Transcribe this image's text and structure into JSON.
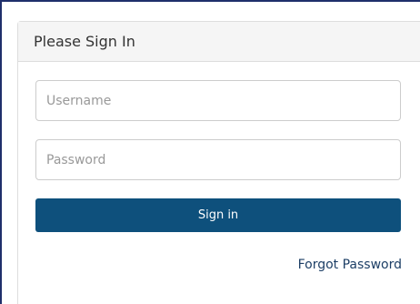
{
  "panel": {
    "title": "Please Sign In"
  },
  "form": {
    "username_placeholder": "Username",
    "username_value": "",
    "password_placeholder": "Password",
    "password_value": "",
    "signin_label": "Sign in",
    "forgot_label": "Forgot Password"
  },
  "colors": {
    "primary_button": "#0e507c",
    "link": "#1d3f66",
    "frame_border": "#1f2f6b",
    "heading_background": "#f5f5f5"
  }
}
